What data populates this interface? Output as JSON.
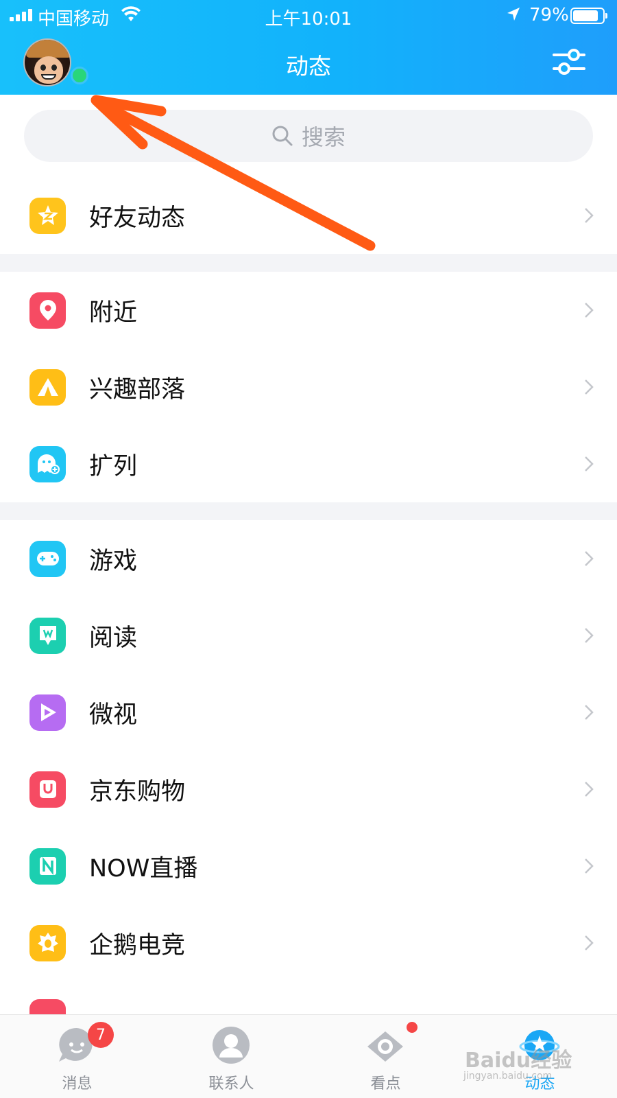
{
  "status_bar": {
    "carrier": "中国移动",
    "time": "上午10:01",
    "battery": "79%"
  },
  "header": {
    "title": "动态"
  },
  "search": {
    "placeholder": "搜索"
  },
  "menu": {
    "group1": [
      {
        "label": "好友动态",
        "icon": "qzone-star-icon",
        "color": "#ffc41c"
      }
    ],
    "group2": [
      {
        "label": "附近",
        "icon": "location-pin-icon",
        "color": "#f64b63"
      },
      {
        "label": "兴趣部落",
        "icon": "tent-icon",
        "color": "#ffbe16"
      },
      {
        "label": "扩列",
        "icon": "add-friend-icon",
        "color": "#21c6f4"
      }
    ],
    "group3": [
      {
        "label": "游戏",
        "icon": "gamepad-icon",
        "color": "#21c6f4"
      },
      {
        "label": "阅读",
        "icon": "bookmark-icon",
        "color": "#1ccfb0"
      },
      {
        "label": "微视",
        "icon": "play-icon",
        "color": "#b66cf2"
      },
      {
        "label": "京东购物",
        "icon": "shopping-bag-icon",
        "color": "#f64b63"
      },
      {
        "label": "NOW直播",
        "icon": "now-live-icon",
        "color": "#1ccfb0"
      },
      {
        "label": "企鹅电竞",
        "icon": "esports-badge-icon",
        "color": "#ffbe16"
      }
    ]
  },
  "tabbar": {
    "tabs": [
      {
        "label": "消息",
        "badge": "7"
      },
      {
        "label": "联系人"
      },
      {
        "label": "看点"
      },
      {
        "label": "动态"
      }
    ]
  },
  "watermark": {
    "text": "Baidu经验",
    "sub": "jingyan.baidu.com"
  },
  "colors": {
    "header_start": "#18c0fb",
    "header_end": "#1f9efb",
    "arrow": "#ff5a14",
    "badge": "#f54646",
    "online": "#29d67a"
  }
}
